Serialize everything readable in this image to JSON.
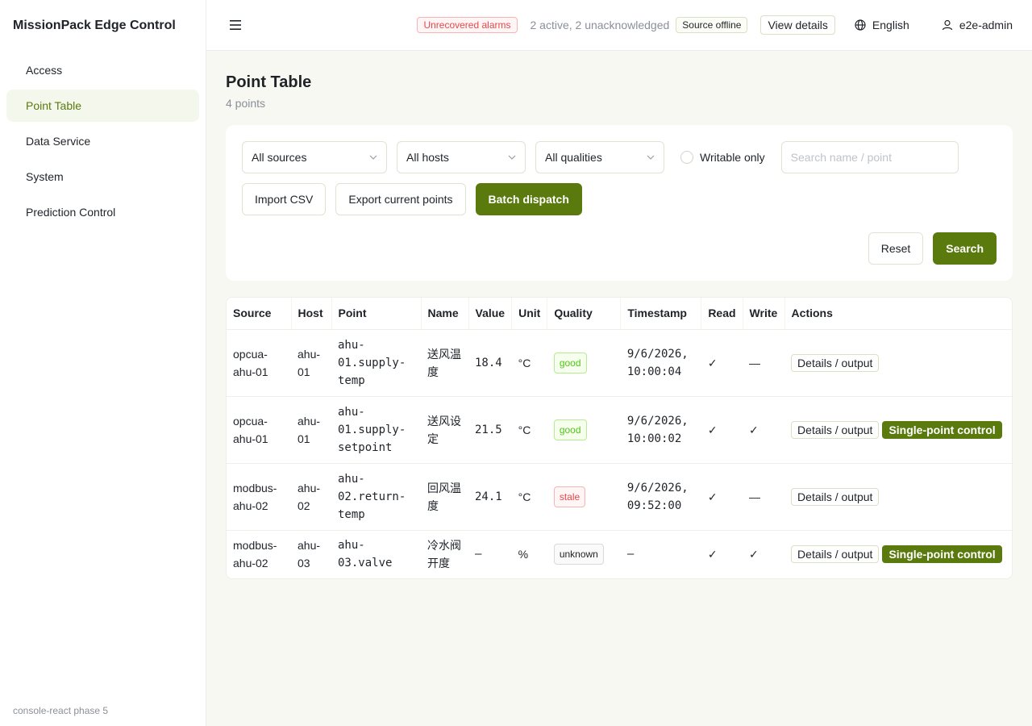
{
  "app": {
    "brand": "MissionPack Edge Control",
    "footer": "console-react phase 5"
  },
  "sidebar": {
    "items": [
      {
        "label": "Access",
        "active": false
      },
      {
        "label": "Point Table",
        "active": true
      },
      {
        "label": "Data Service",
        "active": false
      },
      {
        "label": "System",
        "active": false
      },
      {
        "label": "Prediction Control",
        "active": false
      }
    ]
  },
  "topbar": {
    "alarm_tag": "Unrecovered alarms",
    "alarm_text": "2 active, 2 unacknowledged",
    "offline_tag": "Source offline",
    "view_details": "View details",
    "language": "English",
    "user": "e2e-admin"
  },
  "page": {
    "title": "Point Table",
    "subtitle": "4 points"
  },
  "filters": {
    "source": "All sources",
    "host": "All hosts",
    "quality": "All qualities",
    "writable_label": "Writable only",
    "search_placeholder": "Search name / point",
    "import_csv": "Import CSV",
    "export_points": "Export current points",
    "batch_dispatch": "Batch dispatch",
    "reset": "Reset",
    "search": "Search"
  },
  "table": {
    "columns": [
      "Source",
      "Host",
      "Point",
      "Name",
      "Value",
      "Unit",
      "Quality",
      "Timestamp",
      "Read",
      "Write",
      "Actions"
    ],
    "details_label": "Details / output",
    "control_label": "Single-point control",
    "rows": [
      {
        "source": "opcua-ahu-01",
        "host": "ahu-01",
        "point": "ahu-01.supply-temp",
        "name": "送风温度",
        "value": "18.4",
        "unit": "°C",
        "quality": "good",
        "timestamp": "9/6/2026, 10:00:04",
        "read": "✓",
        "write": "—",
        "control": false
      },
      {
        "source": "opcua-ahu-01",
        "host": "ahu-01",
        "point": "ahu-01.supply-setpoint",
        "name": "送风设定",
        "value": "21.5",
        "unit": "°C",
        "quality": "good",
        "timestamp": "9/6/2026, 10:00:02",
        "read": "✓",
        "write": "✓",
        "control": true
      },
      {
        "source": "modbus-ahu-02",
        "host": "ahu-02",
        "point": "ahu-02.return-temp",
        "name": "回风温度",
        "value": "24.1",
        "unit": "°C",
        "quality": "stale",
        "timestamp": "9/6/2026, 09:52:00",
        "read": "✓",
        "write": "—",
        "control": false
      },
      {
        "source": "modbus-ahu-02",
        "host": "ahu-03",
        "point": "ahu-03.valve",
        "name": "冷水阀开度",
        "value": "—",
        "unit": "%",
        "quality": "unknown",
        "timestamp": "—",
        "read": "✓",
        "write": "✓",
        "control": true
      }
    ]
  }
}
